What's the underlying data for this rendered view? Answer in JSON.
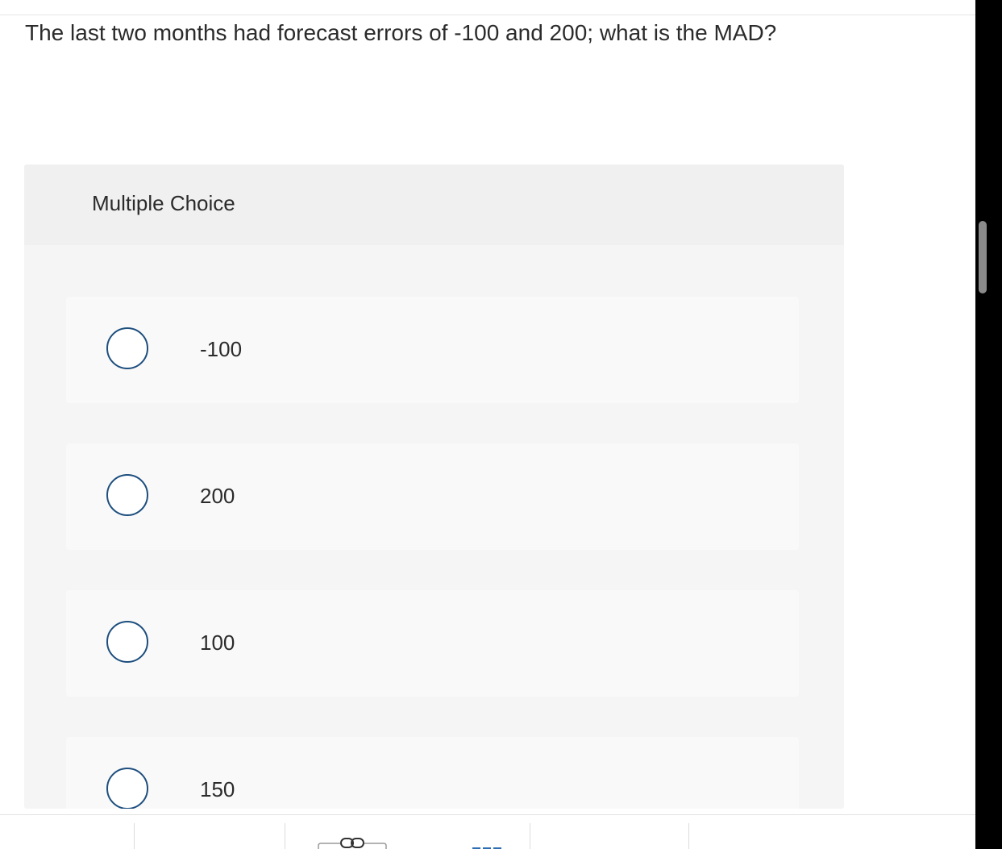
{
  "question": {
    "text": "The last two months had forecast errors of -100 and 200; what is the MAD?"
  },
  "choices": {
    "header": "Multiple Choice",
    "options": [
      {
        "label": "-100"
      },
      {
        "label": "200"
      },
      {
        "label": "100"
      },
      {
        "label": "150"
      }
    ]
  },
  "toolbar": {
    "icons": [
      "link-icon",
      "dash-icon"
    ]
  },
  "colors": {
    "radio_border": "#1d4e7e",
    "panel_bg": "#f5f5f5",
    "header_bg": "#f0f0f0",
    "option_bg": "#f9f9f9",
    "text": "#2b2b2b",
    "scrollbar_track": "#000000",
    "scrollbar_thumb": "#8a8a8a"
  }
}
